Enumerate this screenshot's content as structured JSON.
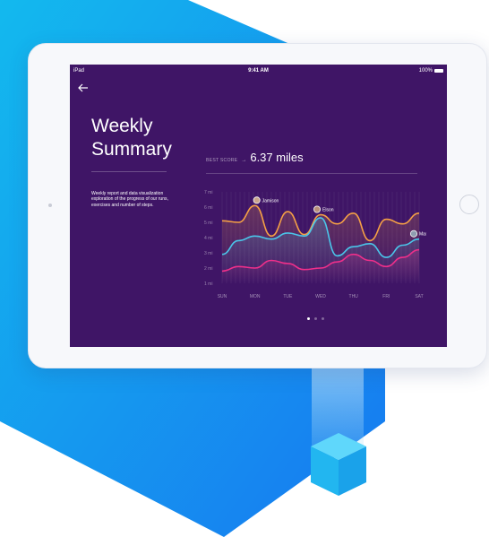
{
  "status_bar": {
    "left": "iPad",
    "time": "9:41 AM",
    "battery": "100%"
  },
  "page": {
    "title_line1": "Weekly",
    "title_line2": "Summary",
    "description": "Weekly report and data visualization exploration of the progress of our runs, exercises and number of steps."
  },
  "best_score": {
    "label": "BEST SCORE",
    "value": "6.37 miles"
  },
  "chart_data": {
    "type": "line",
    "x": [
      "SUN",
      "MON",
      "TUE",
      "WED",
      "THU",
      "FRI",
      "SAT"
    ],
    "y_ticks": [
      "1 mi",
      "2 mi",
      "3 mi",
      "4 mi",
      "5 mi",
      "6 mi",
      "7 mi"
    ],
    "ylim": [
      1,
      7
    ],
    "series": [
      {
        "name": "Jamison",
        "color": "#f5a045",
        "values": [
          5.1,
          5.0,
          6.1,
          4.1,
          5.7,
          4.2,
          5.5,
          4.9,
          5.6,
          3.8,
          5.2,
          4.9,
          5.6
        ]
      },
      {
        "name": "Elson",
        "color": "#4ac6ea",
        "values": [
          2.9,
          3.8,
          4.1,
          3.9,
          4.3,
          4.1,
          5.3,
          2.8,
          3.4,
          3.6,
          2.7,
          3.5,
          3.9
        ]
      },
      {
        "name": "Max",
        "color": "#ef2f8a",
        "values": [
          1.8,
          2.1,
          2.0,
          2.5,
          2.3,
          1.9,
          2.0,
          2.4,
          2.9,
          2.5,
          2.1,
          2.7,
          3.2
        ]
      }
    ],
    "grid": true,
    "legend": "avatar labels on peaks"
  },
  "dots": {
    "count": 3,
    "active": 0
  }
}
